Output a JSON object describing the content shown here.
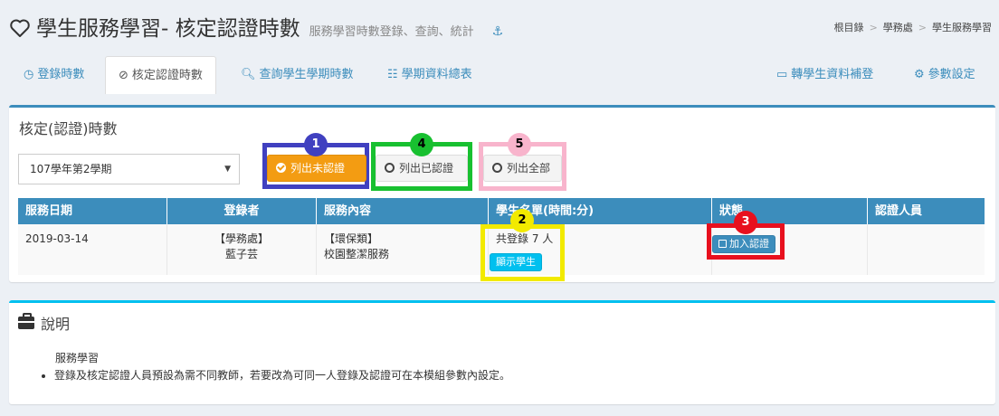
{
  "header": {
    "title": "學生服務學習- 核定認證時數",
    "subtitle": "服務學習時數登錄、查詢、統計",
    "anchor_icon": "⚓",
    "breadcrumb": [
      "根目錄",
      "學務處",
      "學生服務學習"
    ]
  },
  "tabs": [
    {
      "label": "登錄時數",
      "icon": "◷",
      "icon_name": "clock-icon",
      "active": false
    },
    {
      "label": "核定認證時數",
      "icon": "⊘",
      "icon_name": "check-circle-icon",
      "active": true
    },
    {
      "label": "查詢學生學期時數",
      "icon": "🔍︎",
      "icon_name": "search-icon",
      "active": false
    },
    {
      "label": "學期資料總表",
      "icon": "☷",
      "icon_name": "list-icon",
      "active": false
    },
    {
      "label": "轉學生資料補登",
      "icon": "▭",
      "icon_name": "keyboard-icon",
      "active": false
    },
    {
      "label": "參數設定",
      "icon": "⚙",
      "icon_name": "gear-icon",
      "active": false
    }
  ],
  "verify_box": {
    "title": "核定(認證)時數",
    "semester_select": "107學年第2學期",
    "filter_buttons": {
      "unverified": "列出未認證",
      "verified": "列出已認證",
      "all": "列出全部"
    },
    "annotations": [
      "1",
      "4",
      "5",
      "2",
      "3"
    ],
    "table": {
      "headers": [
        "服務日期",
        "登錄者",
        "服務內容",
        "學生名單(時間:分)",
        "狀態",
        "認證人員"
      ],
      "rows": [
        {
          "date": "2019-03-14",
          "registrar_dept": "【學務處】",
          "registrar_name": "藍子芸",
          "content_type": "【環保類】",
          "content": "校園整潔服務",
          "student_summary": "共登錄 7 人",
          "show_students_label": "顯示學生",
          "status_button": "加入認證",
          "verifier": ""
        }
      ]
    }
  },
  "info_box": {
    "title": "說明",
    "heading": "服務學習",
    "items": [
      "登錄及核定認證人員預設為需不同教師，若要改為可同一人登錄及認證可在本模組參數內設定。"
    ]
  },
  "colors": {
    "primary": "#3c8dbc",
    "warning": "#f39c12",
    "info": "#00c0ef",
    "annotation_blue": "#4040c0",
    "annotation_green": "#18c030",
    "annotation_pink": "#f8b4cc",
    "annotation_yellow": "#f2ea00",
    "annotation_red": "#e8101e"
  }
}
